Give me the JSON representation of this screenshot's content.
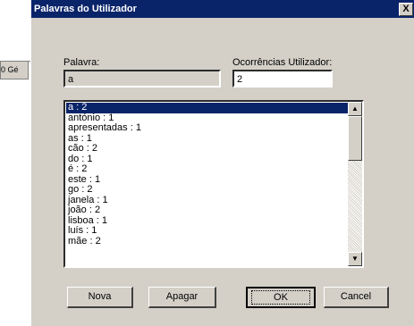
{
  "background": {
    "tab_label": "0 Gé"
  },
  "dialog": {
    "title": "Palavras do Utilizador",
    "close_label": "X",
    "word_label": "Palavra:",
    "word_value": "a",
    "occurrences_label": "Ocorrências Utilizador:",
    "occurrences_value": "2",
    "list_items": [
      "a : 2",
      "antónio : 1",
      "apresentadas : 1",
      "as : 1",
      "cão : 2",
      "do : 1",
      "é : 2",
      "este : 1",
      "go : 2",
      "janela : 1",
      "joão : 2",
      "lisboa : 1",
      "luís : 1",
      "mãe : 2"
    ],
    "selected_index": 0,
    "buttons": {
      "new": "Nova",
      "delete": "Apagar",
      "ok": "OK",
      "cancel": "Cancel"
    }
  },
  "colors": {
    "face": "#d4d0c8",
    "titlebar": "#0a246a",
    "selection": "#0a246a"
  }
}
